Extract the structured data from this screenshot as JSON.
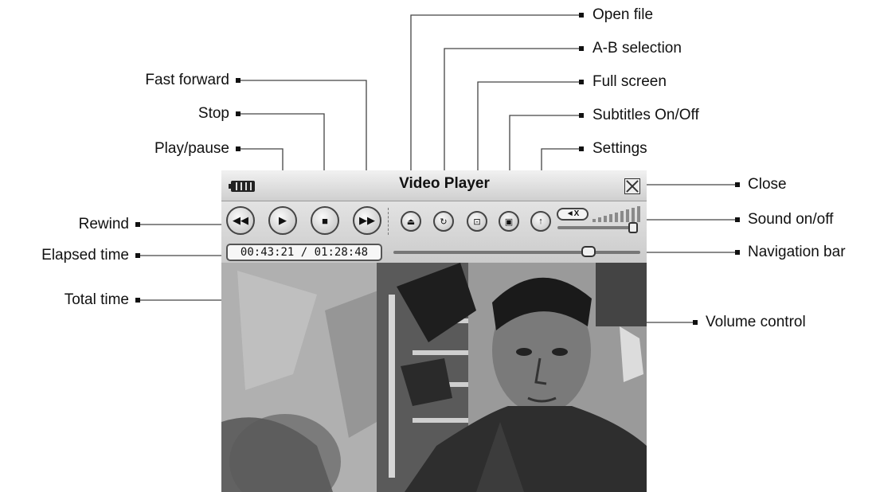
{
  "player": {
    "title": "Video Player",
    "time_display": "00:43:21 / 01:28:48",
    "navigation_progress": 0.79,
    "volume_level": 0.95
  },
  "callouts": {
    "open_file": "Open file",
    "ab_selection": "A-B selection",
    "full_screen": "Full screen",
    "subtitles": "Subtitles On/Off",
    "settings": "Settings",
    "fast_forward": "Fast forward",
    "stop": "Stop",
    "play_pause": "Play/pause",
    "rewind": "Rewind",
    "elapsed_time": "Elapsed time",
    "total_time": "Total time",
    "close": "Close",
    "sound_on_off": "Sound on/off",
    "navigation_bar": "Navigation bar",
    "volume_control": "Volume control"
  },
  "icons": {
    "battery": "battery-icon",
    "close": "close-icon",
    "rewind": "rewind-icon",
    "play": "play-icon",
    "stop": "stop-icon",
    "fast_forward": "fast-forward-icon",
    "open_file": "eject-icon",
    "ab_selection": "ab-repeat-icon",
    "full_screen": "full-screen-icon",
    "subtitles": "subtitles-icon",
    "settings": "settings-icon",
    "mute": "speaker-mute-icon"
  },
  "mute_label": "◄X"
}
